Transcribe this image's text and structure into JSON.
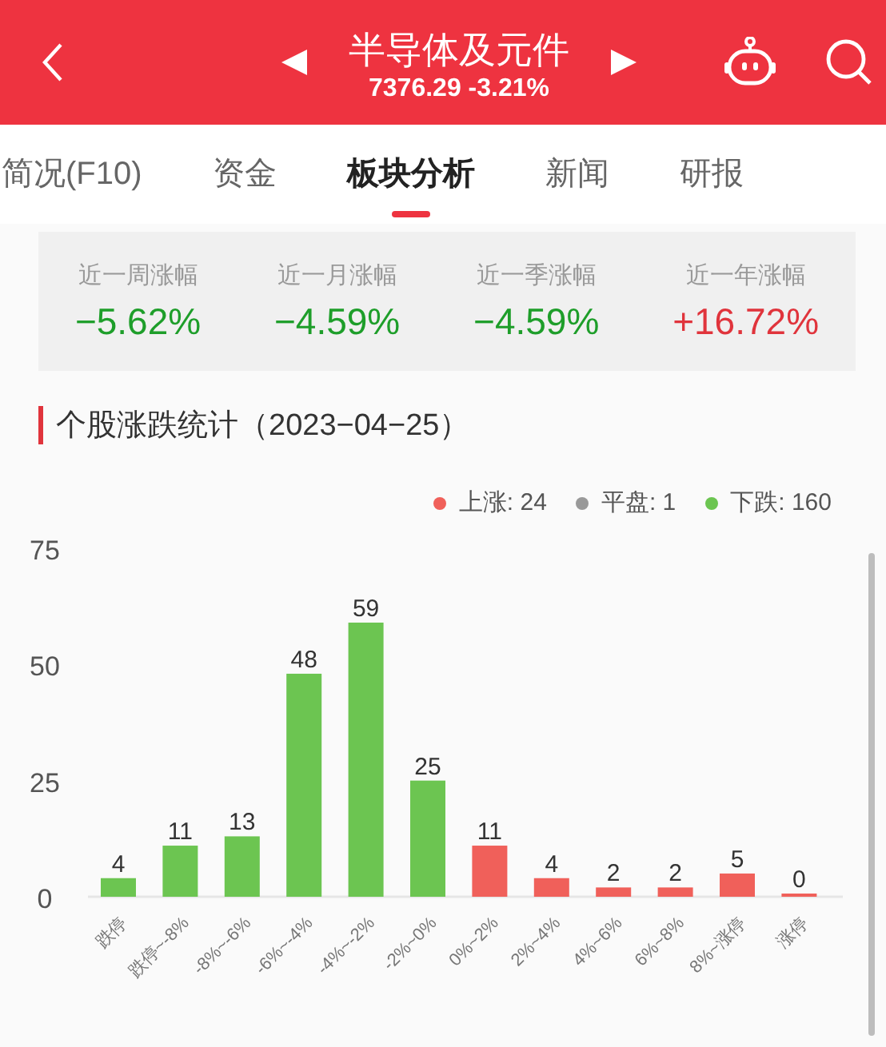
{
  "header": {
    "title": "半导体及元件",
    "subtitle": "7376.29 -3.21%"
  },
  "tabs": [
    {
      "label": "简况(F10)",
      "selected": false
    },
    {
      "label": "资金",
      "selected": false
    },
    {
      "label": "板块分析",
      "selected": true
    },
    {
      "label": "新闻",
      "selected": false
    },
    {
      "label": "研报",
      "selected": false
    }
  ],
  "stats": [
    {
      "label": "近一周涨幅",
      "value": "−5.62%",
      "color": "#1e9e2a"
    },
    {
      "label": "近一月涨幅",
      "value": "−4.59%",
      "color": "#1e9e2a"
    },
    {
      "label": "近一季涨幅",
      "value": "−4.59%",
      "color": "#1e9e2a"
    },
    {
      "label": "近一年涨幅",
      "value": "+16.72%",
      "color": "#e0343c"
    }
  ],
  "section": {
    "title": "个股涨跌统计（2023−04−25）"
  },
  "legend": [
    {
      "label": "上涨: 24",
      "color": "#f0605a"
    },
    {
      "label": "平盘: 1",
      "color": "#999999"
    },
    {
      "label": "下跌: 160",
      "color": "#6cc551"
    }
  ],
  "chart_data": {
    "type": "bar",
    "categories": [
      "跌停",
      "跌停~-8%",
      "-8%~-6%",
      "-6%~-4%",
      "-4%~-2%",
      "-2%~0%",
      "0%~2%",
      "2%~4%",
      "4%~6%",
      "6%~8%",
      "8%~涨停",
      "涨停"
    ],
    "series": [
      {
        "color": "#6cc551",
        "values": [
          4,
          11,
          13,
          48,
          59,
          25,
          null,
          null,
          null,
          null,
          null,
          null
        ]
      },
      {
        "color": "#f0605a",
        "values": [
          null,
          null,
          null,
          null,
          null,
          null,
          11,
          4,
          2,
          2,
          5,
          0
        ]
      }
    ],
    "stacked": true,
    "ylim": [
      0,
      75
    ],
    "yticks": [
      0,
      25,
      50,
      75
    ],
    "data_labels": true
  }
}
